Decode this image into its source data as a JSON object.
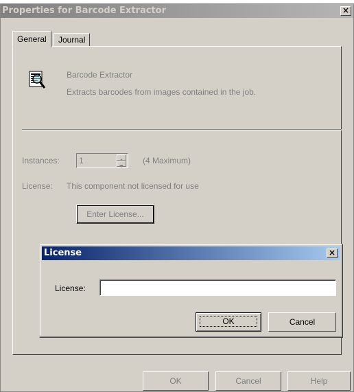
{
  "window": {
    "title": "Properties for Barcode Extractor",
    "close_glyph": "×"
  },
  "tabs": [
    {
      "label": "General",
      "selected": true
    },
    {
      "label": "Journal",
      "selected": false
    }
  ],
  "component": {
    "icon": "magnifier-document-icon",
    "name": "Barcode Extractor",
    "description": "Extracts barcodes from images contained in the job."
  },
  "instances": {
    "label": "Instances:",
    "value": "1",
    "max_text": "(4 Maximum)"
  },
  "license": {
    "label": "License:",
    "status": "This component not licensed for use",
    "enter_button": "Enter License..."
  },
  "license_dialog": {
    "title": "License",
    "close_glyph": "×",
    "field_label": "License:",
    "field_value": "",
    "ok_label": "OK",
    "cancel_label": "Cancel"
  },
  "footer": {
    "ok_label": "OK",
    "cancel_label": "Cancel",
    "help_label": "Help"
  },
  "colors": {
    "face": "#d4d0c8",
    "active_title": "#0a246a",
    "inactive_title": "#808080",
    "disabled_text": "#808080"
  }
}
